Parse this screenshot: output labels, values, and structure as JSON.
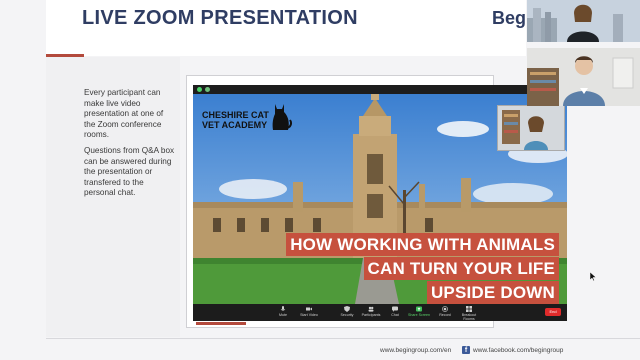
{
  "slide": {
    "title": "LIVE ZOOM PRESENTATION",
    "brand": "Begin",
    "description": [
      "Every participant can make live video presentation at one of the Zoom conference rooms.",
      "Questions from Q&A box can be answered during the presentation or transfered to the personal chat."
    ]
  },
  "zoom": {
    "academy_label_line1": "CHESHIRE CAT",
    "academy_label_line2": "VET ACADEMY",
    "headline": [
      "HOW WORKING WITH ANIMALS",
      "CAN TURN YOUR LIFE",
      "UPSIDE DOWN"
    ],
    "toolbar": [
      {
        "icon": "microphone-icon",
        "label": "Mute"
      },
      {
        "icon": "video-camera-icon",
        "label": "Start Video"
      },
      {
        "icon": "shield-icon",
        "label": "Security"
      },
      {
        "icon": "participants-icon",
        "label": "Participants"
      },
      {
        "icon": "chat-icon",
        "label": "Chat"
      },
      {
        "icon": "share-screen-icon",
        "label": "Share Screen"
      },
      {
        "icon": "record-icon",
        "label": "Record"
      },
      {
        "icon": "breakout-rooms-icon",
        "label": "Breakout Rooms"
      }
    ],
    "end_label": "End"
  },
  "footer": {
    "website": "www.begingroup.com/en",
    "facebook": "www.facebook.com/begingroup"
  },
  "colors": {
    "accent": "#b34a3c",
    "title": "#2f3d63",
    "headline_bg": "#c6513e"
  }
}
